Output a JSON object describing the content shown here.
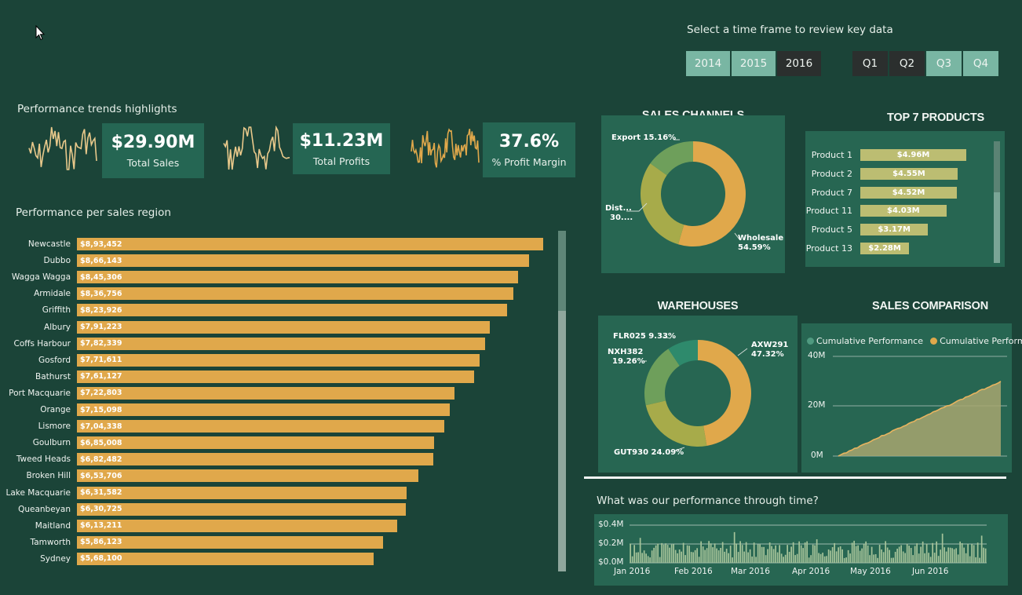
{
  "colors": {
    "background": "#1b4438",
    "panel": "#276652",
    "accent_orange": "#e0a84b",
    "accent_olive": "#a7ab4a",
    "accent_green": "#6e9f5b",
    "accent_teal": "#2e8a6c",
    "slicer_selected": "#79b6a3",
    "slicer_unselected": "#2b2f2e"
  },
  "time_selector": {
    "prompt": "Select a time frame to review key data",
    "years": [
      {
        "label": "2014",
        "selected": true
      },
      {
        "label": "2015",
        "selected": true
      },
      {
        "label": "2016",
        "selected": false
      }
    ],
    "quarters": [
      {
        "label": "Q1",
        "selected": false
      },
      {
        "label": "Q2",
        "selected": false
      },
      {
        "label": "Q3",
        "selected": true
      },
      {
        "label": "Q4",
        "selected": true
      }
    ]
  },
  "kpis": {
    "section_label": "Performance trends highlights",
    "items": [
      {
        "value": "$29.90M",
        "label": "Total Sales"
      },
      {
        "value": "$11.23M",
        "label": "Total Profits"
      },
      {
        "value": "37.6%",
        "label": "% Profit Margin"
      }
    ]
  },
  "regions": {
    "section_label": "Performance per sales region",
    "rows": [
      {
        "name": "Newcastle",
        "label": "$8,93,452",
        "value": 893452
      },
      {
        "name": "Dubbo",
        "label": "$8,66,143",
        "value": 866143
      },
      {
        "name": "Wagga Wagga",
        "label": "$8,45,306",
        "value": 845306
      },
      {
        "name": "Armidale",
        "label": "$8,36,756",
        "value": 836756
      },
      {
        "name": "Griffith",
        "label": "$8,23,926",
        "value": 823926
      },
      {
        "name": "Albury",
        "label": "$7,91,223",
        "value": 791223
      },
      {
        "name": "Coffs Harbour",
        "label": "$7,82,339",
        "value": 782339
      },
      {
        "name": "Gosford",
        "label": "$7,71,611",
        "value": 771611
      },
      {
        "name": "Bathurst",
        "label": "$7,61,127",
        "value": 761127
      },
      {
        "name": "Port Macquarie",
        "label": "$7,22,803",
        "value": 722803
      },
      {
        "name": "Orange",
        "label": "$7,15,098",
        "value": 715098
      },
      {
        "name": "Lismore",
        "label": "$7,04,338",
        "value": 704338
      },
      {
        "name": "Goulburn",
        "label": "$6,85,008",
        "value": 685008
      },
      {
        "name": "Tweed Heads",
        "label": "$6,82,482",
        "value": 682482
      },
      {
        "name": "Broken Hill",
        "label": "$6,53,706",
        "value": 653706
      },
      {
        "name": "Lake Macquarie",
        "label": "$6,31,582",
        "value": 631582
      },
      {
        "name": "Queanbeyan",
        "label": "$6,30,725",
        "value": 630725
      },
      {
        "name": "Maitland",
        "label": "$6,13,211",
        "value": 613211
      },
      {
        "name": "Tamworth",
        "label": "$5,86,123",
        "value": 586123
      },
      {
        "name": "Sydney",
        "label": "$5,68,100",
        "value": 568100
      }
    ]
  },
  "sales_channels": {
    "title": "SALES CHANNELS",
    "slices": [
      {
        "label": "Wholesale",
        "pct_label": "54.59%",
        "value": 54.59,
        "color": "#e0a84b"
      },
      {
        "label": "Dist...",
        "pct_label": "30....",
        "value": 30.25,
        "color": "#a7ab4a"
      },
      {
        "label": "Export",
        "pct_label": "15.16%",
        "value": 15.16,
        "color": "#6e9f5b"
      }
    ]
  },
  "top_products": {
    "title": "TOP 7 PRODUCTS",
    "rows": [
      {
        "name": "Product 1",
        "label": "$4.96M",
        "value": 4.96
      },
      {
        "name": "Product 2",
        "label": "$4.55M",
        "value": 4.55
      },
      {
        "name": "Product 7",
        "label": "$4.52M",
        "value": 4.52
      },
      {
        "name": "Product 11",
        "label": "$4.03M",
        "value": 4.03
      },
      {
        "name": "Product 5",
        "label": "$3.17M",
        "value": 3.17
      },
      {
        "name": "Product 13",
        "label": "$2.28M",
        "value": 2.28
      }
    ]
  },
  "warehouses": {
    "title": "WAREHOUSES",
    "slices": [
      {
        "label": "AXW291",
        "pct_label": "47.32%",
        "value": 47.32,
        "color": "#e0a84b"
      },
      {
        "label": "GUT930",
        "pct_label": "24.09%",
        "value": 24.09,
        "color": "#a7ab4a"
      },
      {
        "label": "NXH382",
        "pct_label": "19.26%",
        "value": 19.26,
        "color": "#6e9f5b"
      },
      {
        "label": "FLR025",
        "pct_label": "9.33%",
        "value": 9.33,
        "color": "#2e8a6c"
      }
    ]
  },
  "sales_comparison": {
    "title": "SALES COMPARISON",
    "legend": [
      {
        "label": "Cumulative Performance",
        "color": "#4f9a80"
      },
      {
        "label": "Cumulative Perform...",
        "color": "#e0a84b"
      }
    ],
    "y_ticks": [
      "40M",
      "20M",
      "0M"
    ],
    "y_max": 40,
    "end_value": 30
  },
  "time_chart": {
    "title": "What was our performance through time?",
    "y_ticks": [
      "$0.4M",
      "$0.2M",
      "$0.0M"
    ],
    "x_ticks": [
      "Jan 2016",
      "Feb 2016",
      "Mar 2016",
      "Apr 2016",
      "May 2016",
      "Jun 2016"
    ]
  }
}
